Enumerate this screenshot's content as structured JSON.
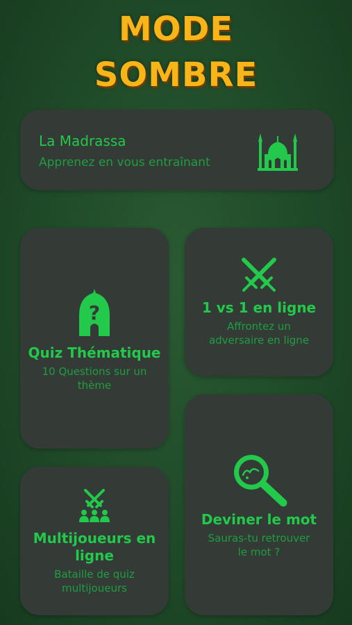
{
  "header": {
    "line1": "MODE",
    "line2": "SOMBRE"
  },
  "colors": {
    "accent": "#22c94a",
    "title": "#f7b51a",
    "card": "#343b37"
  },
  "cards": {
    "madrassa": {
      "title": "La Madrassa",
      "subtitle": "Apprenez en vous entraînant",
      "icon": "mosque-icon"
    },
    "quiz": {
      "title": "Quiz Thématique",
      "subtitle_line1": "10 Questions sur un",
      "subtitle_line2": "thème",
      "icon": "question-dome-icon"
    },
    "versus": {
      "title": "1 vs 1 en ligne",
      "subtitle_line1": "Affrontez un",
      "subtitle_line2": "adversaire en ligne",
      "icon": "crossed-swords-icon"
    },
    "multi": {
      "title_line1": "Multijoueurs en",
      "title_line2": "ligne",
      "subtitle_line1": "Bataille de quiz",
      "subtitle_line2": "multijoueurs",
      "icon": "swords-group-icon"
    },
    "deviner": {
      "title": "Deviner le mot",
      "subtitle_line1": "Sauras-tu retrouver",
      "subtitle_line2": "le mot ?",
      "icon": "magnifier-icon"
    }
  }
}
